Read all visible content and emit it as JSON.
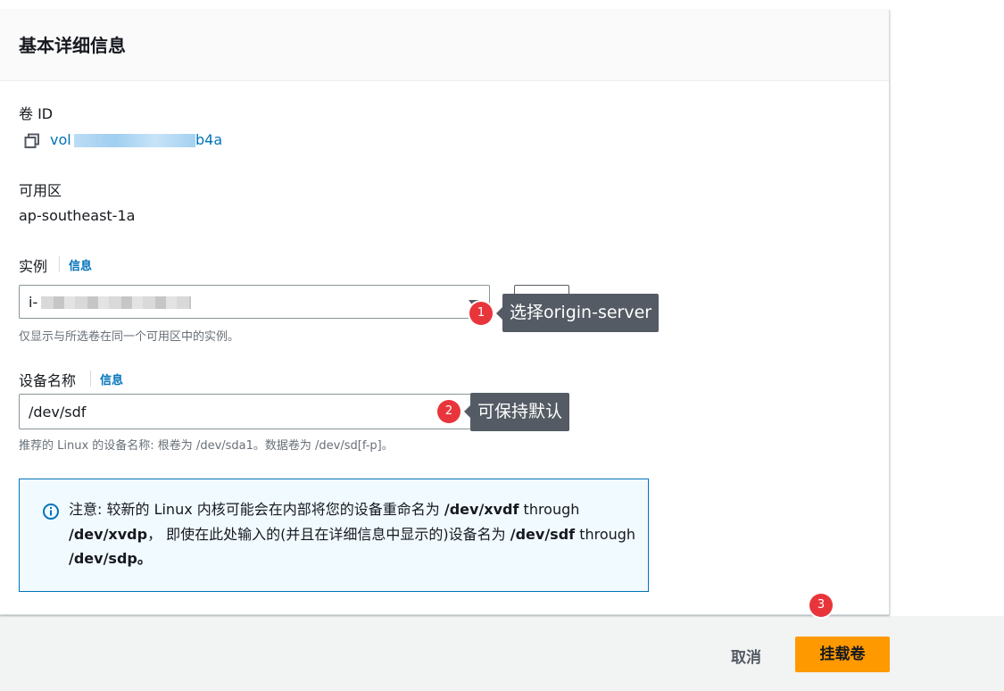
{
  "page": {
    "title": "基本详细信息"
  },
  "volume": {
    "label": "卷 ID",
    "prefix": "vol",
    "suffix": "b4a"
  },
  "az": {
    "label": "可用区",
    "value": "ap-southeast-1a"
  },
  "instance": {
    "label": "实例",
    "info": "信息",
    "prefix": "i-",
    "hint": "仅显示与所选卷在同一个可用区中的实例。"
  },
  "device": {
    "label": "设备名称",
    "info": "信息",
    "value": "/dev/sdf",
    "hint": "推荐的 Linux 的设备名称: 根卷为 /dev/sda1。数据卷为 /dev/sd[f-p]。"
  },
  "alert": {
    "p1": "注意: 较新的 Linux 内核可能会在内部将您的设备重命名为 ",
    "b1": "/dev/xvdf",
    "p2": " through ",
    "b2": "/dev/xvdp",
    "p3": "， 即使在此处输入的(并且在详细信息中显示的)设备名为 ",
    "b3": "/dev/sdf",
    "p4": " through ",
    "b4": "/dev/sdp。"
  },
  "annotations": [
    {
      "num": "1",
      "text": "选择origin-server"
    },
    {
      "num": "2",
      "text": "可保持默认"
    },
    {
      "num": "3"
    }
  ],
  "actions": {
    "cancel": "取消",
    "submit": "挂载卷"
  },
  "colors": {
    "accent": "#ff9900",
    "link": "#0073bb",
    "badge": "#e8353b",
    "tooltip": "#545b64"
  },
  "icons": [
    "copy-icon",
    "caret-down-icon",
    "refresh-icon",
    "info-circle-icon"
  ]
}
